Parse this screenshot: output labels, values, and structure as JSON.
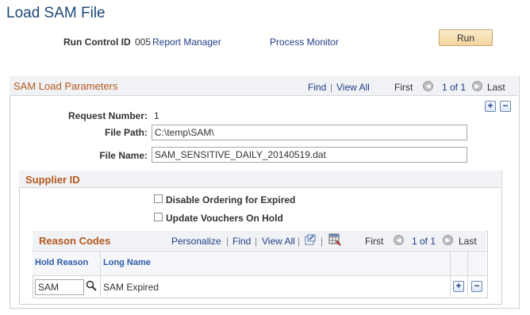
{
  "page": {
    "title": "Load SAM File"
  },
  "run_control": {
    "label": "Run Control ID",
    "value": "005",
    "report_manager": "Report Manager",
    "process_monitor": "Process Monitor",
    "run_button": "Run"
  },
  "params": {
    "header": "SAM Load Parameters",
    "find": "Find",
    "sep": "|",
    "view_all": "View All",
    "first": "First",
    "page_info": "1 of 1",
    "last": "Last",
    "request_number_label": "Request Number:",
    "request_number_value": "1",
    "file_path_label": "File Path:",
    "file_path_value": "C:\\temp\\SAM\\",
    "file_name_label": "File Name:",
    "file_name_value": "SAM_SENSITIVE_DAILY_20140519.dat"
  },
  "supplier": {
    "header": "Supplier ID",
    "disable_ordering": "Disable Ordering for Expired",
    "update_vouchers": "Update Vouchers On Hold"
  },
  "reason_codes": {
    "header": "Reason Codes",
    "personalize": "Personalize",
    "find": "Find",
    "view_all": "View All",
    "first": "First",
    "page_info": "1 of 1",
    "last": "Last",
    "columns": [
      "Hold Reason",
      "Long Name"
    ],
    "rows": [
      {
        "hold_reason": "SAM",
        "long_name": "SAM Expired"
      }
    ]
  },
  "colors": {
    "title": "#1e4a7a",
    "link": "#1e3e84",
    "section_header": "#b4581d",
    "run_button": "#f2d49e"
  },
  "icons": [
    "prev-nav-icon",
    "next-nav-icon",
    "add-row-icon",
    "delete-row-icon",
    "zoom-icon",
    "download-icon",
    "lookup-icon"
  ]
}
